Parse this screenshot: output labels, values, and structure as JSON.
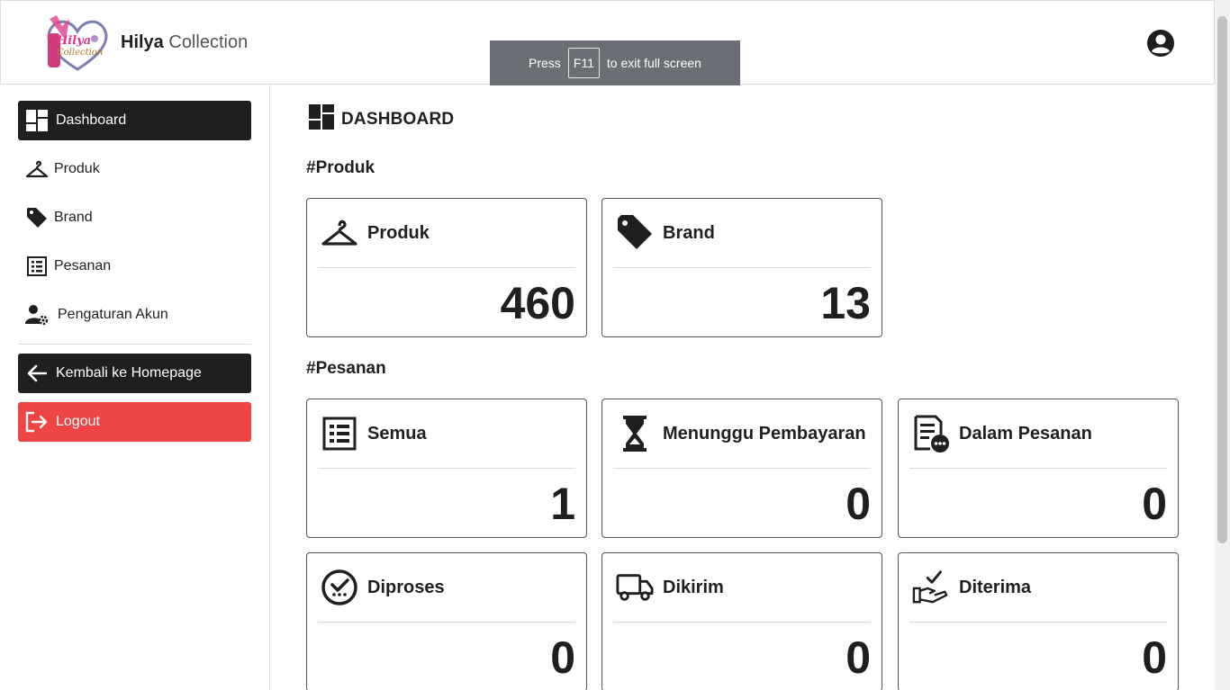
{
  "header": {
    "logo_text": "Hilya Collection",
    "brand_bold": "Hilya",
    "brand_light": " Collection"
  },
  "toast": {
    "pre": "Press",
    "key": "F11",
    "post": "to exit full screen"
  },
  "sidebar": {
    "items": [
      {
        "label": "Dashboard",
        "icon": "dashboard-icon"
      },
      {
        "label": "Produk",
        "icon": "hanger-icon"
      },
      {
        "label": "Brand",
        "icon": "tag-icon"
      },
      {
        "label": "Pesanan",
        "icon": "list-icon"
      },
      {
        "label": "Pengaturan Akun",
        "icon": "user-gear-icon"
      }
    ],
    "back_label": "Kembali ke Homepage",
    "logout_label": "Logout"
  },
  "main": {
    "title": "DASHBOARD",
    "section_produk": "#Produk",
    "section_pesanan": "#Pesanan",
    "cards_produk": [
      {
        "label": "Produk",
        "value": "460",
        "icon": "hanger-icon"
      },
      {
        "label": "Brand",
        "value": "13",
        "icon": "tag-icon"
      }
    ],
    "cards_pesanan": [
      {
        "label": "Semua",
        "value": "1",
        "icon": "list-icon"
      },
      {
        "label": "Menunggu Pembayaran",
        "value": "0",
        "icon": "hourglass-icon"
      },
      {
        "label": "Dalam Pesanan",
        "value": "0",
        "icon": "document-pending-icon"
      },
      {
        "label": "Diproses",
        "value": "0",
        "icon": "check-circle-icon"
      },
      {
        "label": "Dikirim",
        "value": "0",
        "icon": "truck-icon"
      },
      {
        "label": "Diterima",
        "value": "0",
        "icon": "hand-check-icon"
      }
    ]
  },
  "colors": {
    "dark": "#1f1f1f",
    "logout": "#ef4444",
    "toast": "#6b6f75"
  }
}
